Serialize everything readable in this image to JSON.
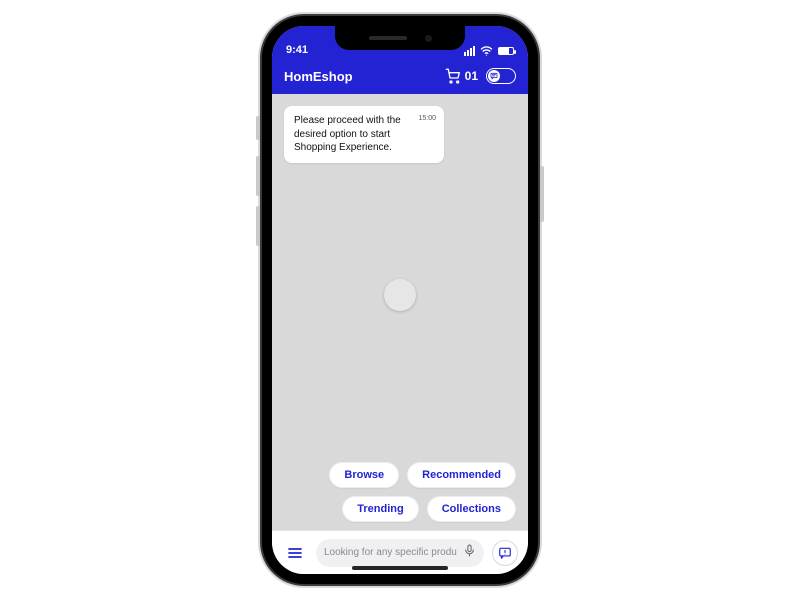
{
  "status": {
    "time": "9:41"
  },
  "header": {
    "app_name": "HomEshop",
    "cart_count": "01"
  },
  "chat": {
    "message": {
      "text": "Please proceed with the desired option to start Shopping Experience.",
      "time": "15:00"
    },
    "chips": [
      "Browse",
      "Recommended",
      "Trending",
      "Collections"
    ]
  },
  "search": {
    "placeholder": "Looking for any specific product?"
  }
}
